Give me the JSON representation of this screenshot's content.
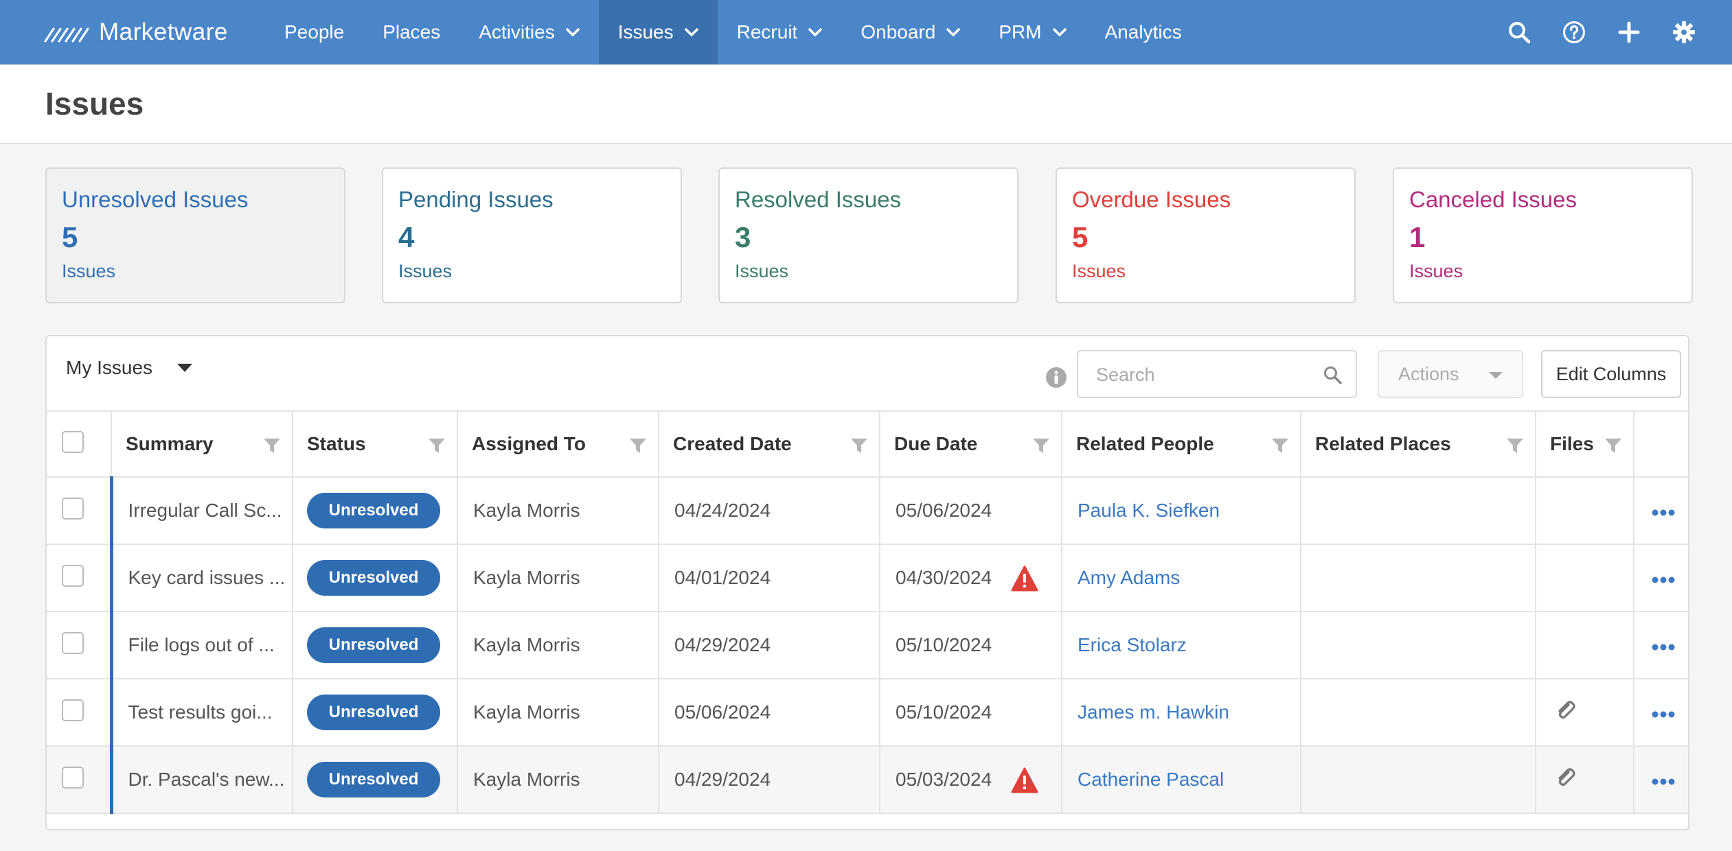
{
  "brand": {
    "name": "Marketware"
  },
  "nav": {
    "items": [
      {
        "label": "People",
        "dropdown": false,
        "active": false
      },
      {
        "label": "Places",
        "dropdown": false,
        "active": false
      },
      {
        "label": "Activities",
        "dropdown": true,
        "active": false
      },
      {
        "label": "Issues",
        "dropdown": true,
        "active": true
      },
      {
        "label": "Recruit",
        "dropdown": true,
        "active": false
      },
      {
        "label": "Onboard",
        "dropdown": true,
        "active": false
      },
      {
        "label": "PRM",
        "dropdown": true,
        "active": false
      },
      {
        "label": "Analytics",
        "dropdown": false,
        "active": false
      }
    ],
    "right_icons": [
      "search-icon",
      "help-icon",
      "plus-icon",
      "gear-icon"
    ]
  },
  "page": {
    "title": "Issues"
  },
  "cards": [
    {
      "title": "Unresolved Issues",
      "count": "5",
      "sub": "Issues",
      "color": "#2e6fb7",
      "active": true
    },
    {
      "title": "Pending Issues",
      "count": "4",
      "sub": "Issues",
      "color": "#2a6e8f",
      "active": false
    },
    {
      "title": "Resolved Issues",
      "count": "3",
      "sub": "Issues",
      "color": "#3a7d6a",
      "active": false
    },
    {
      "title": "Overdue Issues",
      "count": "5",
      "sub": "Issues",
      "color": "#e0403a",
      "active": false
    },
    {
      "title": "Canceled Issues",
      "count": "1",
      "sub": "Issues",
      "color": "#b32c7c",
      "active": false
    }
  ],
  "toolbar": {
    "view_label": "My Issues",
    "search_placeholder": "Search",
    "actions_label": "Actions",
    "edit_columns_label": "Edit Columns"
  },
  "table": {
    "columns": [
      "Summary",
      "Status",
      "Assigned To",
      "Created Date",
      "Due Date",
      "Related People",
      "Related Places",
      "Files"
    ],
    "rows": [
      {
        "summary": "Irregular Call Sc...",
        "status": "Unresolved",
        "assigned": "Kayla Morris",
        "created": "04/24/2024",
        "due": "05/06/2024",
        "overdue": false,
        "person": "Paula K. Siefken",
        "place": "",
        "has_file": false
      },
      {
        "summary": "Key card issues ...",
        "status": "Unresolved",
        "assigned": "Kayla Morris",
        "created": "04/01/2024",
        "due": "04/30/2024",
        "overdue": true,
        "person": "Amy Adams",
        "place": "",
        "has_file": false
      },
      {
        "summary": "File logs out of ...",
        "status": "Unresolved",
        "assigned": "Kayla Morris",
        "created": "04/29/2024",
        "due": "05/10/2024",
        "overdue": false,
        "person": "Erica Stolarz",
        "place": "",
        "has_file": false
      },
      {
        "summary": "Test results goi...",
        "status": "Unresolved",
        "assigned": "Kayla Morris",
        "created": "05/06/2024",
        "due": "05/10/2024",
        "overdue": false,
        "person": "James m. Hawkin",
        "place": "",
        "has_file": true
      },
      {
        "summary": "Dr. Pascal's new...",
        "status": "Unresolved",
        "assigned": "Kayla Morris",
        "created": "04/29/2024",
        "due": "05/03/2024",
        "overdue": true,
        "person": "Catherine Pascal",
        "place": "",
        "has_file": true
      }
    ]
  },
  "colors": {
    "nav_bg": "#4a86c8",
    "nav_active": "#3a70ad",
    "badge": "#2f6db3",
    "link": "#3b79c2",
    "warning": "#e0403a"
  }
}
